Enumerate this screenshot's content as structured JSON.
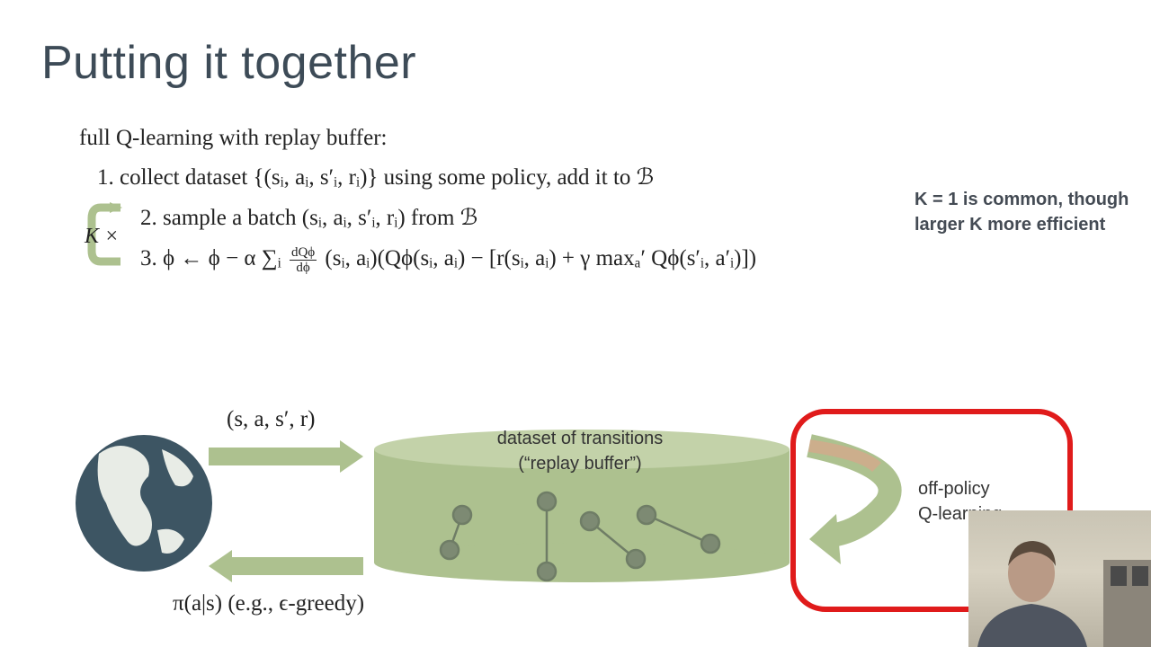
{
  "slide": {
    "title": "Putting it together",
    "algorithm_heading": "full Q-learning with replay buffer:",
    "step1": {
      "num": "1.",
      "text_a": "collect dataset {(",
      "vars": "s",
      "text_full": "collect dataset {(sᵢ, aᵢ, s′ᵢ, rᵢ)} using some policy, add it to ℬ"
    },
    "step2": {
      "num": "2.",
      "text_full": "sample a batch (sᵢ, aᵢ, s′ᵢ, rᵢ) from ℬ"
    },
    "step3": {
      "num": "3.",
      "lhs": "ϕ ← ϕ − α ∑ᵢ",
      "frac_num": "dQϕ",
      "frac_den": "dϕ",
      "rhs": "(sᵢ, aᵢ)(Qϕ(sᵢ, aᵢ) − [r(sᵢ, aᵢ) + γ maxₐ′ Qϕ(s′ᵢ, a′ᵢ)])"
    },
    "repeat_label": "K ×",
    "note": "K = 1 is common, though larger K more efficient",
    "diagram": {
      "transition_label": "(s, a, s′, r)",
      "policy_label": "π(a|s) (e.g., ϵ-greedy)",
      "dataset_label_line1": "dataset of transitions",
      "dataset_label_line2": "(“replay buffer”)",
      "offpolicy_line1": "off-policy",
      "offpolicy_line2": "Q-learning"
    },
    "colors": {
      "title": "#3d4b57",
      "green": "#adc18f",
      "red_box": "#e01b1b",
      "node": "#7d8a73"
    }
  }
}
